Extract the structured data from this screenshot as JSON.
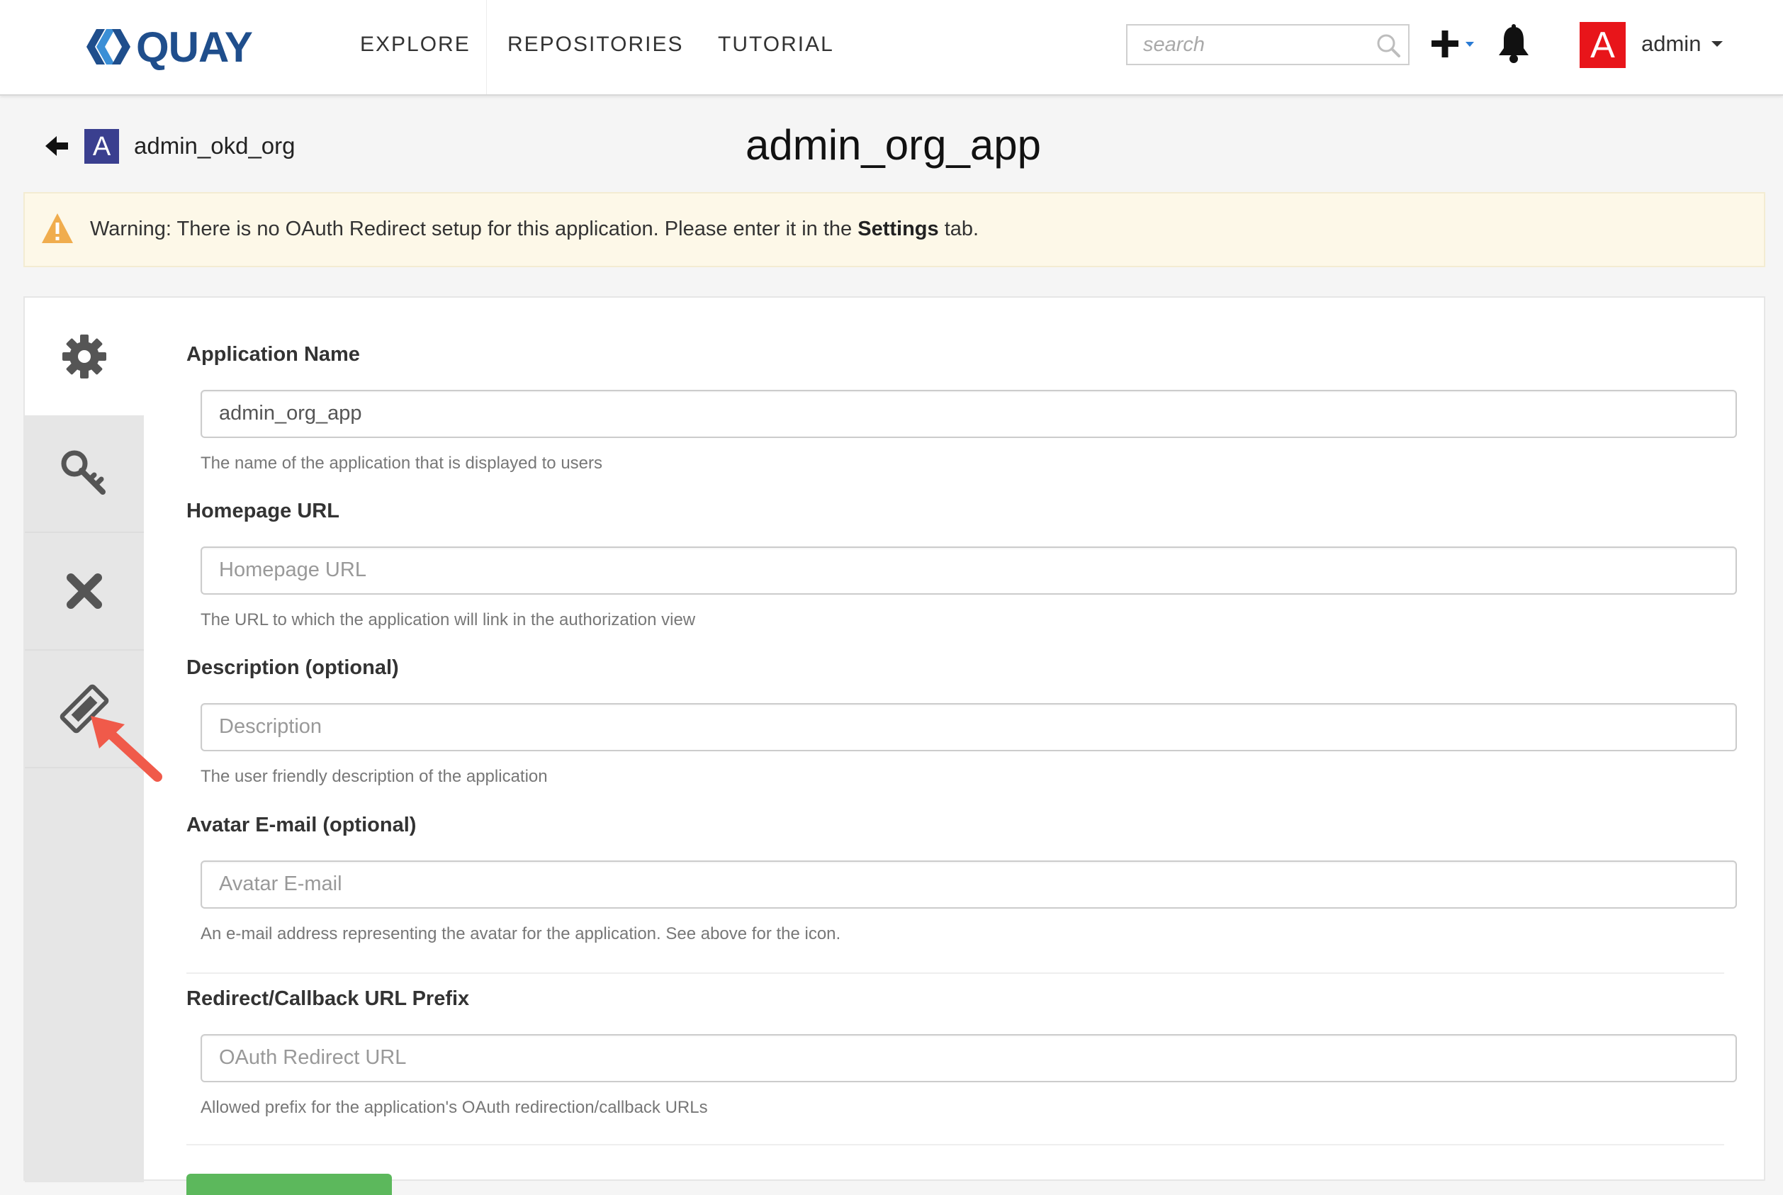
{
  "brand": {
    "name": "QUAY"
  },
  "nav": {
    "links": [
      "EXPLORE",
      "REPOSITORIES",
      "TUTORIAL"
    ],
    "search_placeholder": "search",
    "user": {
      "avatar_letter": "A",
      "name": "admin",
      "avatar_color": "#e8151a"
    }
  },
  "header": {
    "org_avatar_letter": "A",
    "org_name": "admin_okd_org",
    "title": "admin_org_app"
  },
  "warning": {
    "prefix": "Warning: There is no OAuth Redirect setup for this application. Please enter it in the ",
    "bold": "Settings",
    "suffix": " tab."
  },
  "side_tabs": [
    {
      "icon": "gear-icon",
      "active": true
    },
    {
      "icon": "key-icon",
      "active": false
    },
    {
      "icon": "times-icon",
      "active": false
    },
    {
      "icon": "ticket-icon",
      "active": false
    }
  ],
  "form": {
    "app_name": {
      "label": "Application Name",
      "value": "admin_org_app",
      "help": "The name of the application that is displayed to users"
    },
    "homepage": {
      "label": "Homepage URL",
      "placeholder": "Homepage URL",
      "help": "The URL to which the application will link in the authorization view"
    },
    "description": {
      "label": "Description (optional)",
      "placeholder": "Description",
      "help": "The user friendly description of the application"
    },
    "avatar_email": {
      "label": "Avatar E-mail (optional)",
      "placeholder": "Avatar E-mail",
      "help": "An e-mail address representing the avatar for the application. See above for the icon."
    },
    "redirect": {
      "label": "Redirect/Callback URL Prefix",
      "placeholder": "OAuth Redirect URL",
      "help": "Allowed prefix for the application's OAuth redirection/callback URLs"
    }
  },
  "colors": {
    "brand": "#1f4e8c",
    "warning_bg": "#fdf8e8",
    "warning_icon": "#f0ad4e",
    "org_avatar": "#3a3f8f",
    "save_button": "#5cb85c",
    "annotation_arrow": "#f05a4a"
  }
}
